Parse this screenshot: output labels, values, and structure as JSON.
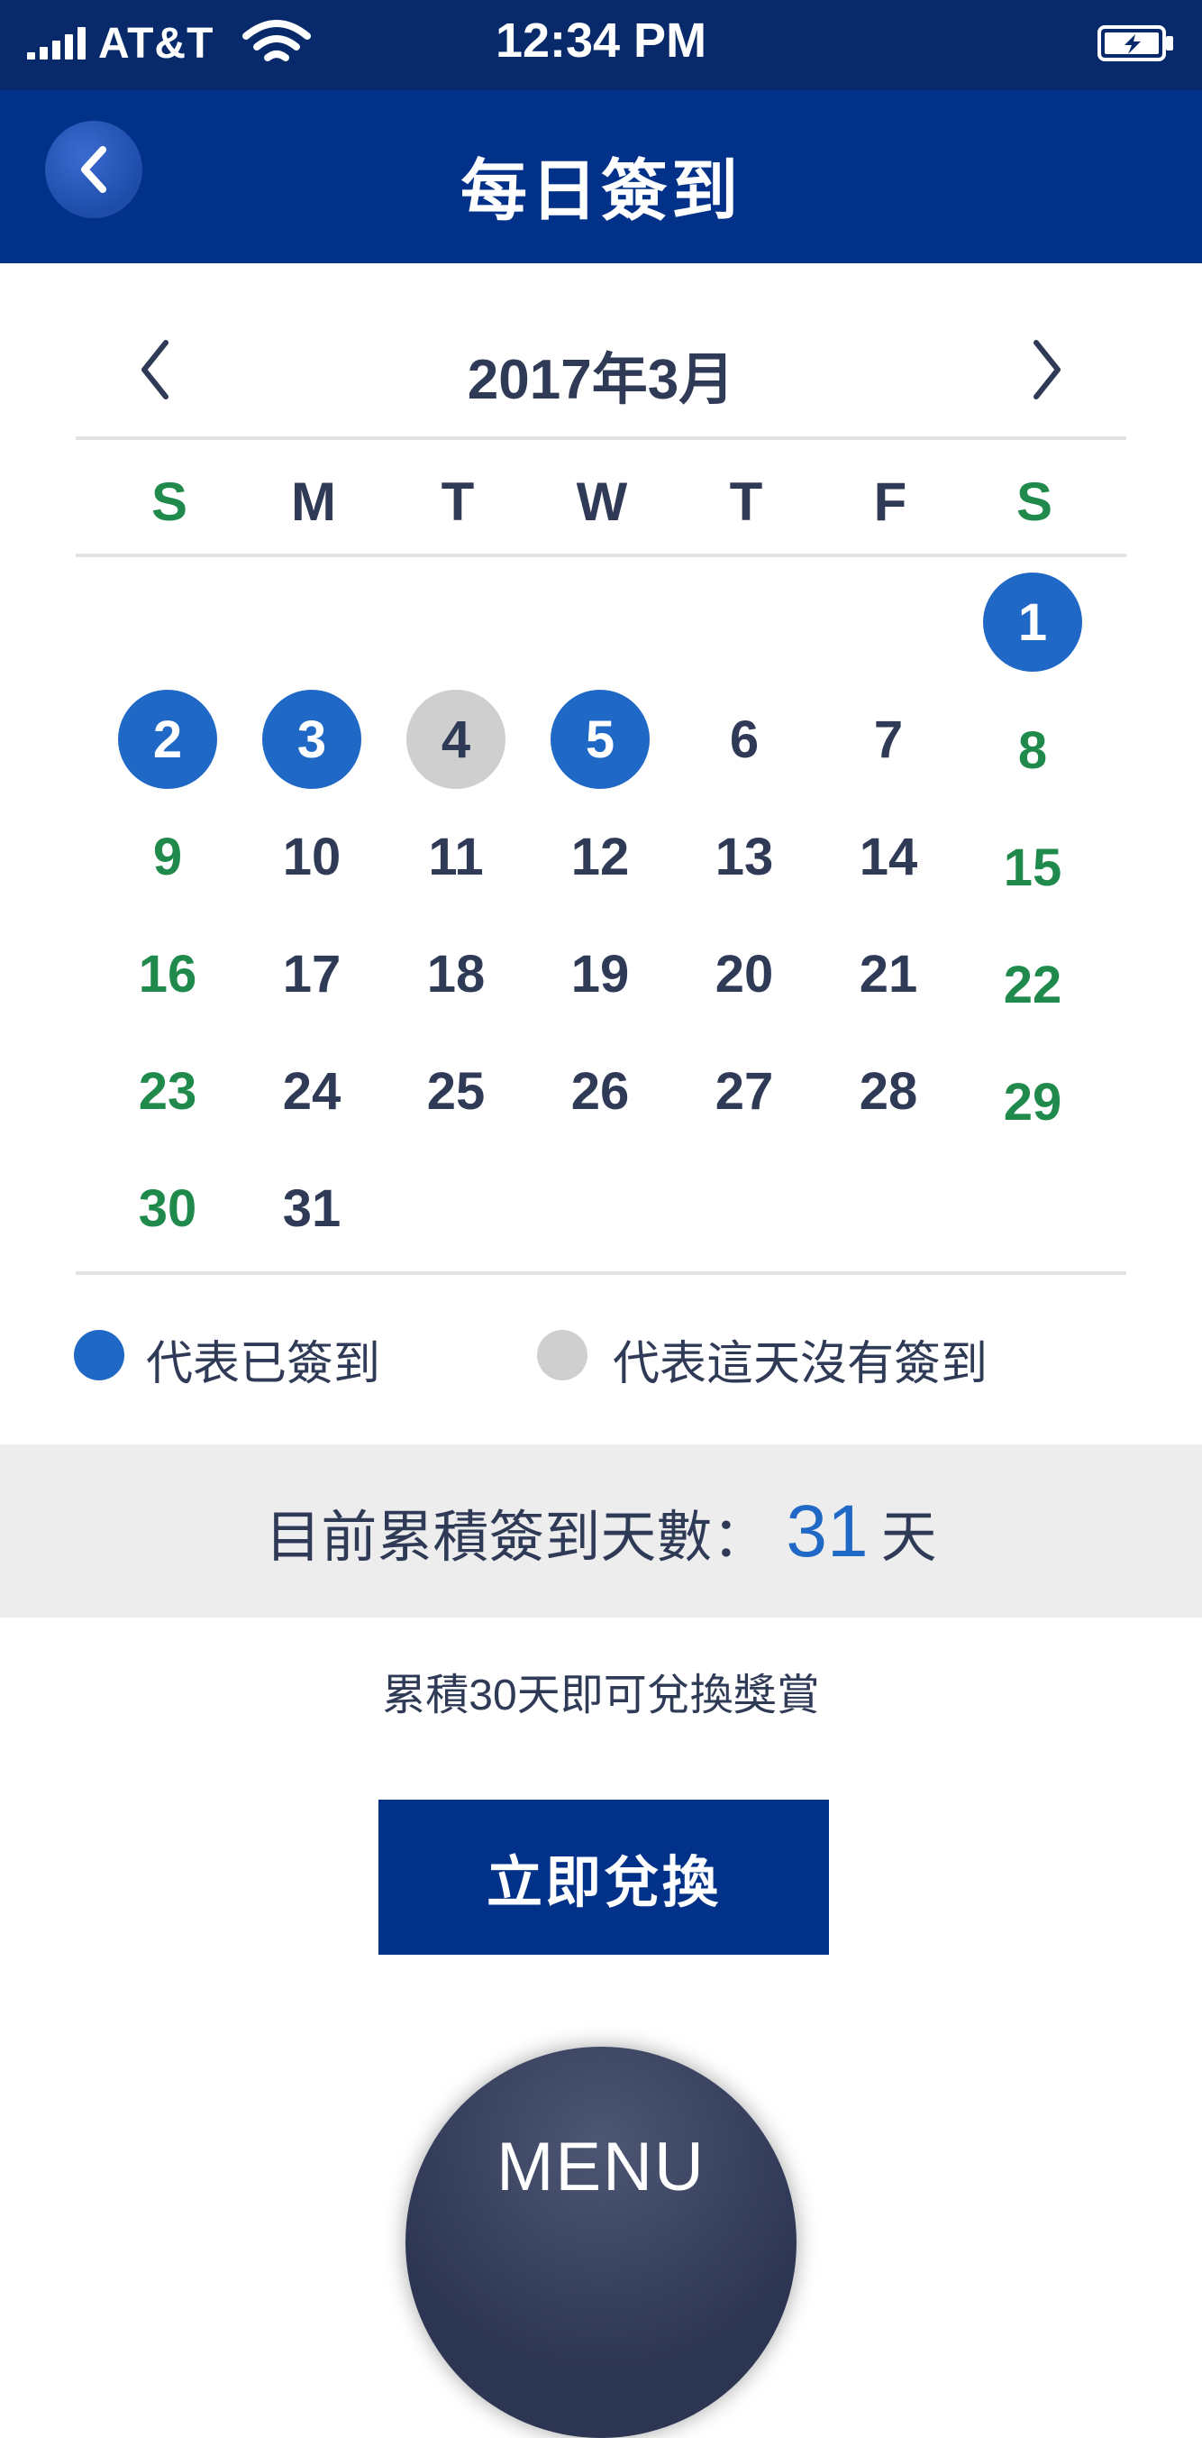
{
  "status_bar": {
    "carrier": "AT&T",
    "time": "12:34 PM",
    "signal_icon": "signal-bars-icon",
    "wifi_icon": "wifi-icon",
    "battery_icon": "battery-charging-icon"
  },
  "header": {
    "title": "每日簽到",
    "back_icon": "chevron-left-icon"
  },
  "calendar": {
    "month_label": "2017年3月",
    "prev_icon": "chevron-left-icon",
    "next_icon": "chevron-right-icon",
    "weekdays": [
      "S",
      "M",
      "T",
      "W",
      "T",
      "F",
      "S"
    ],
    "first_weekday_index": 6,
    "days_in_month": 31,
    "signed_days": [
      1,
      2,
      3,
      5
    ],
    "missed_days": [
      4
    ]
  },
  "legend": {
    "signed_label": "代表已簽到",
    "missed_label": "代表這天沒有簽到"
  },
  "summary": {
    "label": "目前累積簽到天數：",
    "count": "31",
    "unit": "天"
  },
  "note": "累積30天即可兌換獎賞",
  "redeem_button": "立即兌換",
  "menu_button": "MENU",
  "colors": {
    "primary": "#013188",
    "status_bar": "#082a6b",
    "signed": "#2068c6",
    "missed": "#cfcfcf",
    "weekend": "#1f8a4c",
    "text": "#2f3a56"
  }
}
